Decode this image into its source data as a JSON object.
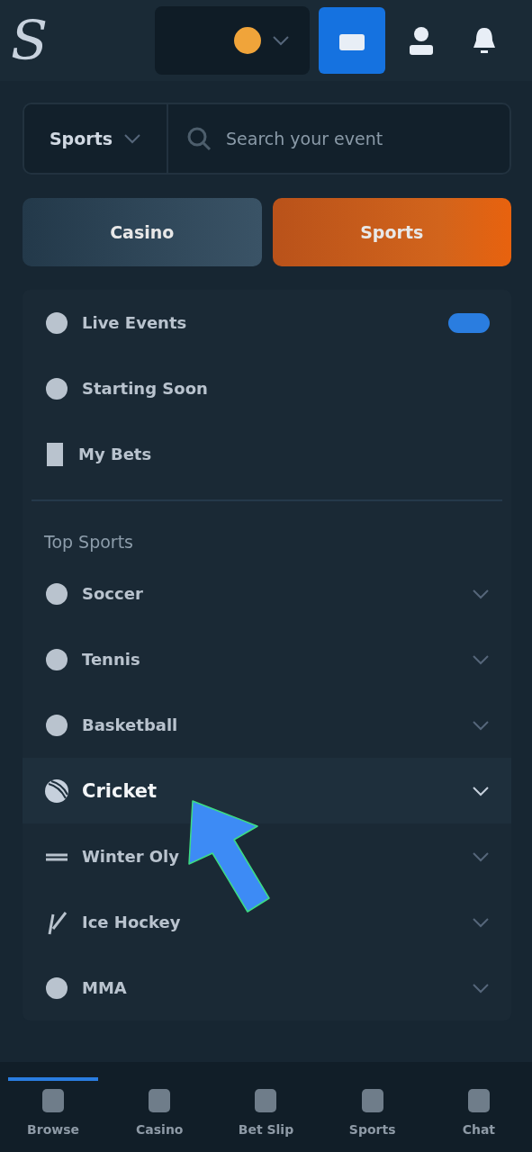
{
  "header": {
    "logo": "S"
  },
  "search": {
    "sport_select": "Sports",
    "placeholder": "Search your event"
  },
  "tabs": [
    {
      "label": "Casino",
      "selected": false
    },
    {
      "label": "Sports",
      "selected": true
    }
  ],
  "quick_links": [
    {
      "label": "Live Events",
      "kind": "live",
      "badge": true
    },
    {
      "label": "Starting Soon",
      "kind": "clock",
      "badge": false
    },
    {
      "label": "My Bets",
      "kind": "slip",
      "badge": false
    }
  ],
  "section_title": "Top Sports",
  "sports": [
    {
      "label": "Soccer",
      "kind": "ball",
      "highlighted": false
    },
    {
      "label": "Tennis",
      "kind": "ball",
      "highlighted": false
    },
    {
      "label": "Basketball",
      "kind": "ball",
      "highlighted": false
    },
    {
      "label": "Cricket",
      "kind": "cricket",
      "highlighted": true
    },
    {
      "label": "Winter Oly",
      "kind": "ski",
      "highlighted": false
    },
    {
      "label": "Ice Hockey",
      "kind": "stick",
      "highlighted": false
    },
    {
      "label": "MMA",
      "kind": "ball",
      "highlighted": false
    }
  ],
  "bottom_nav": [
    {
      "label": "Browse",
      "selected": true
    },
    {
      "label": "Casino",
      "selected": false
    },
    {
      "label": "Bet Slip",
      "selected": false
    },
    {
      "label": "Sports",
      "selected": false
    },
    {
      "label": "Chat",
      "selected": false
    }
  ]
}
